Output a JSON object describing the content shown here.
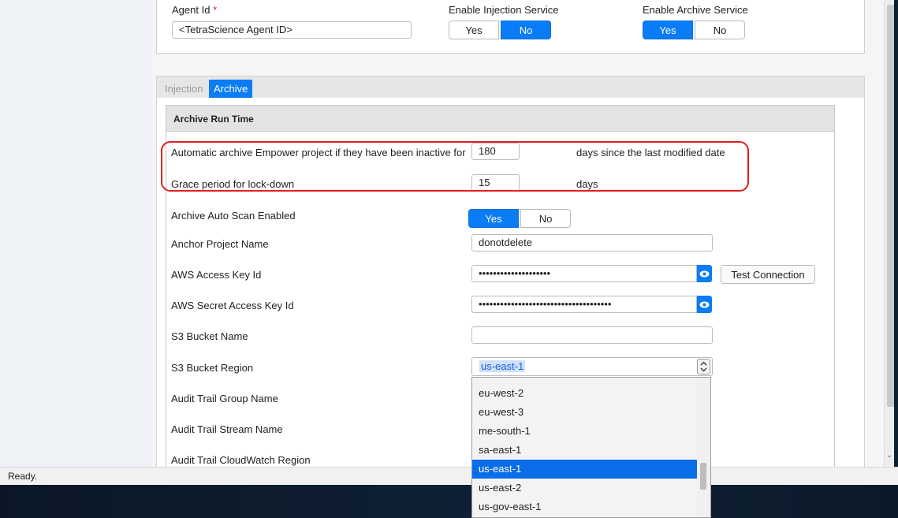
{
  "top_panel": {
    "agent_id_label": "Agent Id",
    "required_mark": "*",
    "agent_id_value": "<TetraScience Agent ID>",
    "injection_service_label": "Enable Injection Service",
    "injection_yes": "Yes",
    "injection_no": "No",
    "injection_selected": "No",
    "archive_service_label": "Enable Archive Service",
    "archive_yes": "Yes",
    "archive_no": "No",
    "archive_selected": "Yes"
  },
  "tabs": [
    {
      "label": "Injection",
      "active": false
    },
    {
      "label": "Archive",
      "active": true
    }
  ],
  "archive": {
    "section_title": "Archive Run Time",
    "inactive_label": "Automatic archive Empower project if they have been inactive for",
    "inactive_days": "180",
    "inactive_unit": "days since the last modified date",
    "grace_label": "Grace period for lock-down",
    "grace_days": "15",
    "grace_unit": "days",
    "auto_scan_label": "Archive Auto Scan Enabled",
    "auto_scan_yes": "Yes",
    "auto_scan_no": "No",
    "auto_scan_selected": "Yes",
    "anchor_label": "Anchor Project Name",
    "anchor_value": "donotdelete",
    "aws_key_label": "AWS Access Key Id",
    "aws_key_value": "••••••••••••••••••••",
    "test_connection": "Test Connection",
    "aws_secret_label": "AWS Secret Access Key Id",
    "aws_secret_value": "•••••••••••••••••••••••••••••••••••••",
    "s3_name_label": "S3 Bucket Name",
    "s3_name_value": "",
    "s3_region_label": "S3 Bucket Region",
    "s3_region_value": "us-east-1",
    "audit_group_label": "Audit Trail Group Name",
    "audit_stream_label": "Audit Trail Stream Name",
    "audit_region_label": "Audit Trail CloudWatch Region"
  },
  "region_dropdown": {
    "options": [
      "eu-west-2",
      "eu-west-3",
      "me-south-1",
      "sa-east-1",
      "us-east-1",
      "us-east-2",
      "us-gov-east-1"
    ],
    "selected": "us-east-1"
  },
  "status": {
    "text": "Ready."
  },
  "colors": {
    "accent": "#0a7cf5",
    "highlight_ring": "#e21f1f"
  }
}
